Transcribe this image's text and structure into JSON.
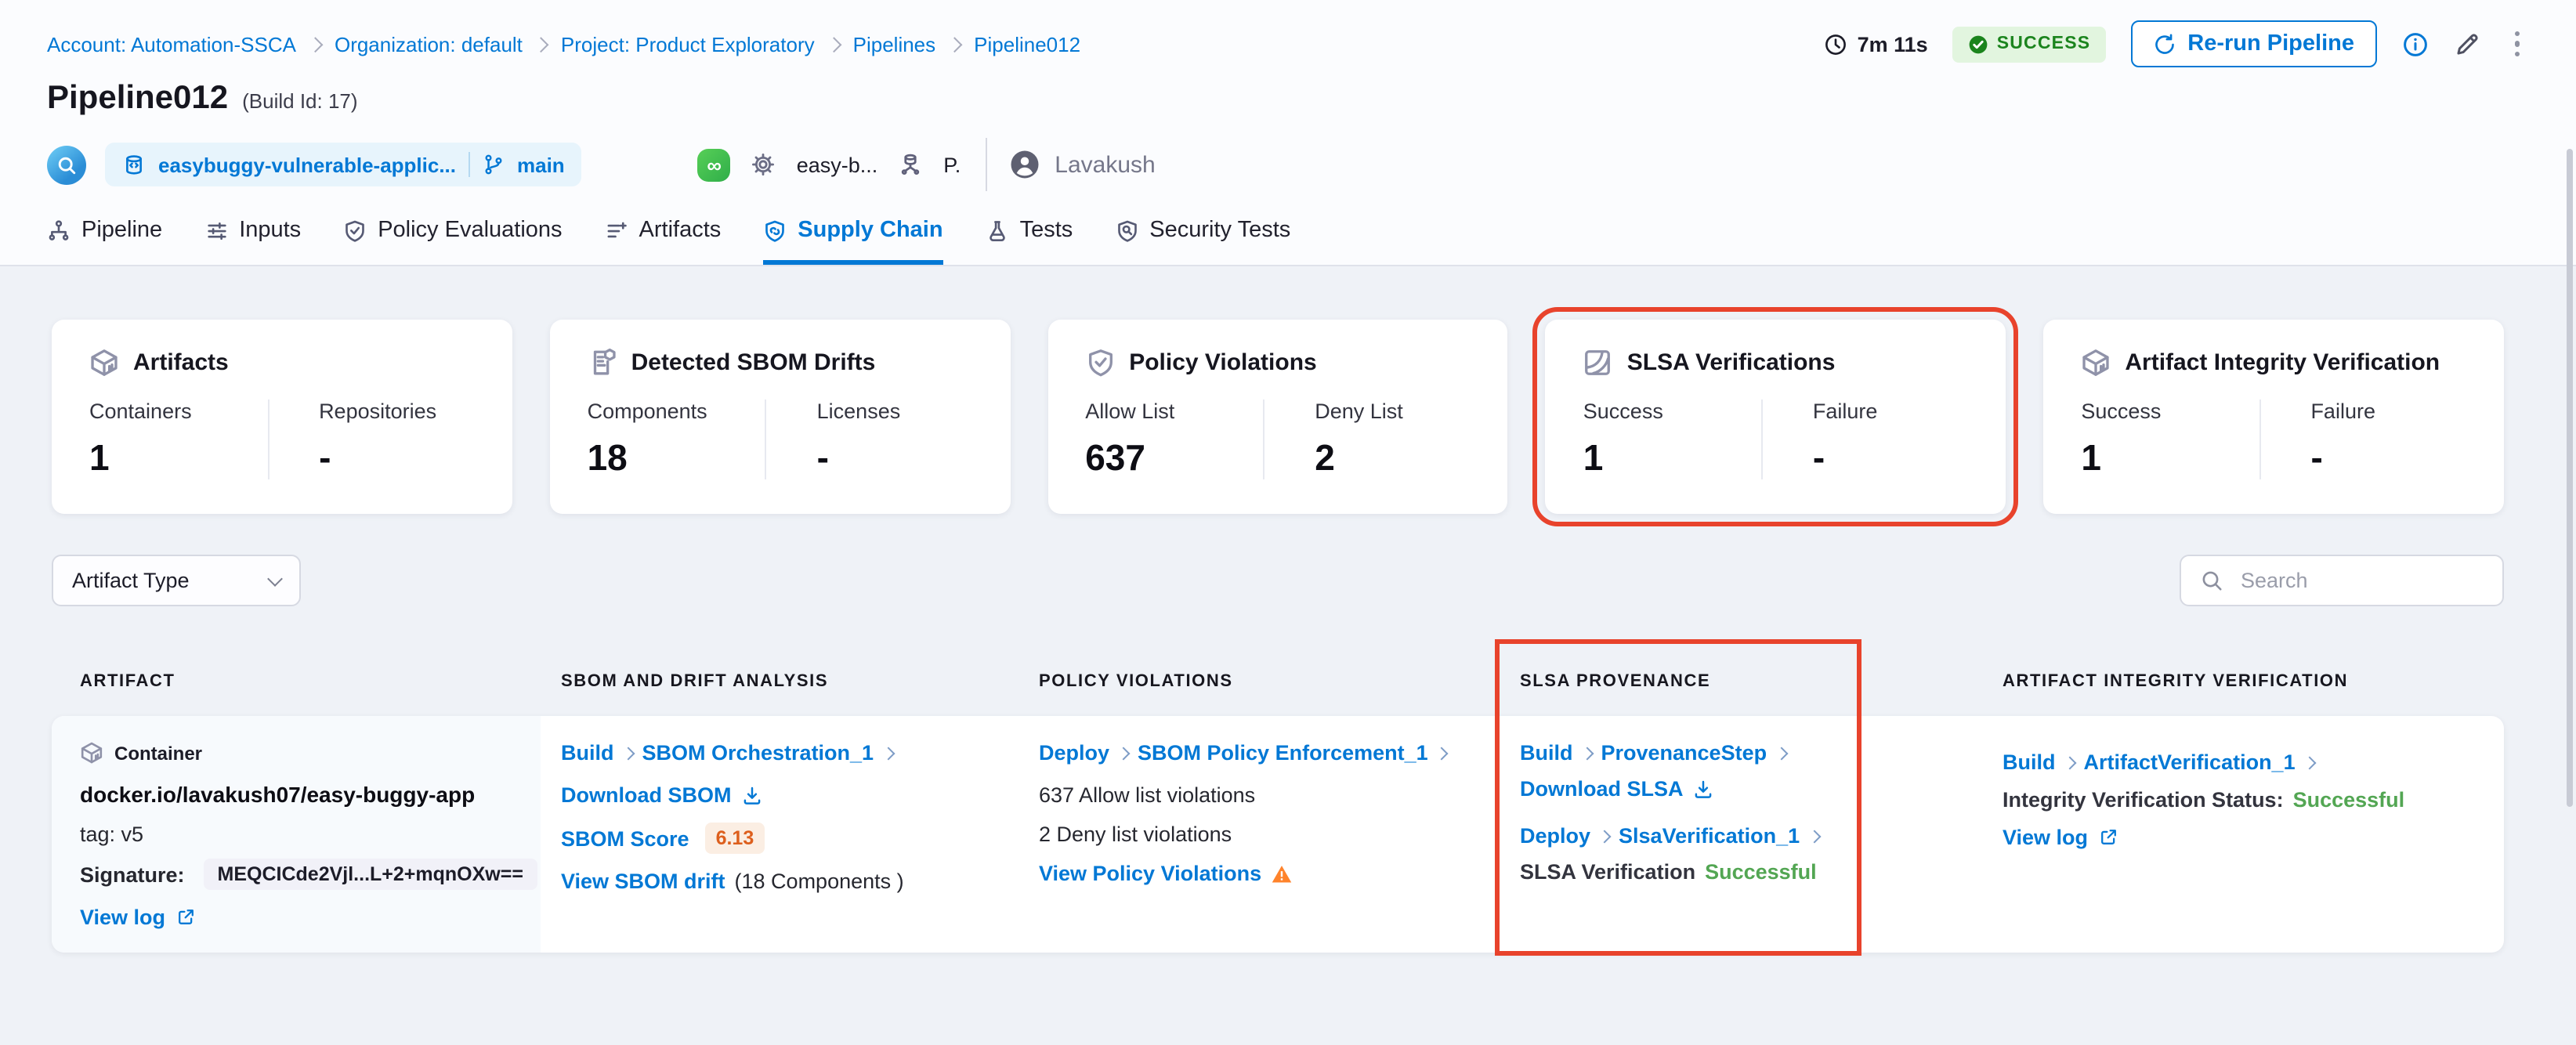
{
  "breadcrumb": {
    "items": [
      "Account: Automation-SSCA",
      "Organization: default",
      "Project: Product Exploratory",
      "Pipelines",
      "Pipeline012"
    ]
  },
  "topbar": {
    "duration": "7m 11s",
    "status_badge": "SUCCESS",
    "rerun_button": "Re-run Pipeline"
  },
  "header": {
    "title": "Pipeline012",
    "build_id": "(Build Id: 17)",
    "repo_name": "easybuggy-vulnerable-applic...",
    "branch": "main",
    "trigger_pipeline": "easy-b...",
    "trigger_initial": "P.",
    "user_name": "Lavakush"
  },
  "tabs": {
    "items": [
      {
        "label": "Pipeline"
      },
      {
        "label": "Inputs"
      },
      {
        "label": "Policy Evaluations"
      },
      {
        "label": "Artifacts"
      },
      {
        "label": "Supply Chain"
      },
      {
        "label": "Tests"
      },
      {
        "label": "Security Tests"
      }
    ],
    "active": "Supply Chain"
  },
  "summary_cards": {
    "artifacts": {
      "title": "Artifacts",
      "stat1_label": "Containers",
      "stat1_value": "1",
      "stat2_label": "Repositories",
      "stat2_value": "-"
    },
    "sbom_drifts": {
      "title": "Detected SBOM Drifts",
      "stat1_label": "Components",
      "stat1_value": "18",
      "stat2_label": "Licenses",
      "stat2_value": "-"
    },
    "policy_violations": {
      "title": "Policy Violations",
      "stat1_label": "Allow List",
      "stat1_value": "637",
      "stat2_label": "Deny List",
      "stat2_value": "2"
    },
    "slsa": {
      "title": "SLSA Verifications",
      "stat1_label": "Success",
      "stat1_value": "1",
      "stat2_label": "Failure",
      "stat2_value": "-",
      "highlighted": true
    },
    "integrity": {
      "title": "Artifact Integrity Verification",
      "stat1_label": "Success",
      "stat1_value": "1",
      "stat2_label": "Failure",
      "stat2_value": "-"
    }
  },
  "filters": {
    "artifact_type": "Artifact Type",
    "search_placeholder": "Search"
  },
  "table": {
    "headers": {
      "artifact": "ARTIFACT",
      "sbom": "SBOM AND DRIFT ANALYSIS",
      "policy": "POLICY VIOLATIONS",
      "slsa": "SLSA PROVENANCE",
      "integrity": "ARTIFACT INTEGRITY VERIFICATION"
    },
    "row": {
      "artifact": {
        "type": "Container",
        "name": "docker.io/lavakush07/easy-buggy-app",
        "tag": "tag: v5",
        "signature_label": "Signature:",
        "signature": "MEQCICde2Vjl...L+2+mqnOXw==",
        "view_log": "View log"
      },
      "sbom": {
        "stage": "Build",
        "step": "SBOM Orchestration_1",
        "download": "Download SBOM",
        "score_label": "SBOM Score",
        "score": "6.13",
        "drift": "View SBOM drift",
        "components": "(18 Components )"
      },
      "policy": {
        "stage": "Deploy",
        "step": "SBOM Policy Enforcement_1",
        "allow": "637 Allow list violations",
        "deny": "2 Deny list violations",
        "view": "View Policy Violations"
      },
      "slsa": {
        "stage1": "Build",
        "step1": "ProvenanceStep",
        "download": "Download SLSA",
        "stage2": "Deploy",
        "step2": "SlsaVerification_1",
        "status_label": "SLSA Verification",
        "status": "Successful"
      },
      "integrity": {
        "stage": "Build",
        "step": "ArtifactVerification_1",
        "status_label": "Integrity Verification Status:",
        "status": "Successful",
        "view_log": "View log"
      }
    }
  },
  "colors": {
    "accent_blue": "#0278d5",
    "success_green": "#1b841d",
    "status_green": "#53a653",
    "highlight_red": "#e8432c",
    "warning_orange": "#ff832b",
    "score_orange": "#dd5f1d"
  }
}
